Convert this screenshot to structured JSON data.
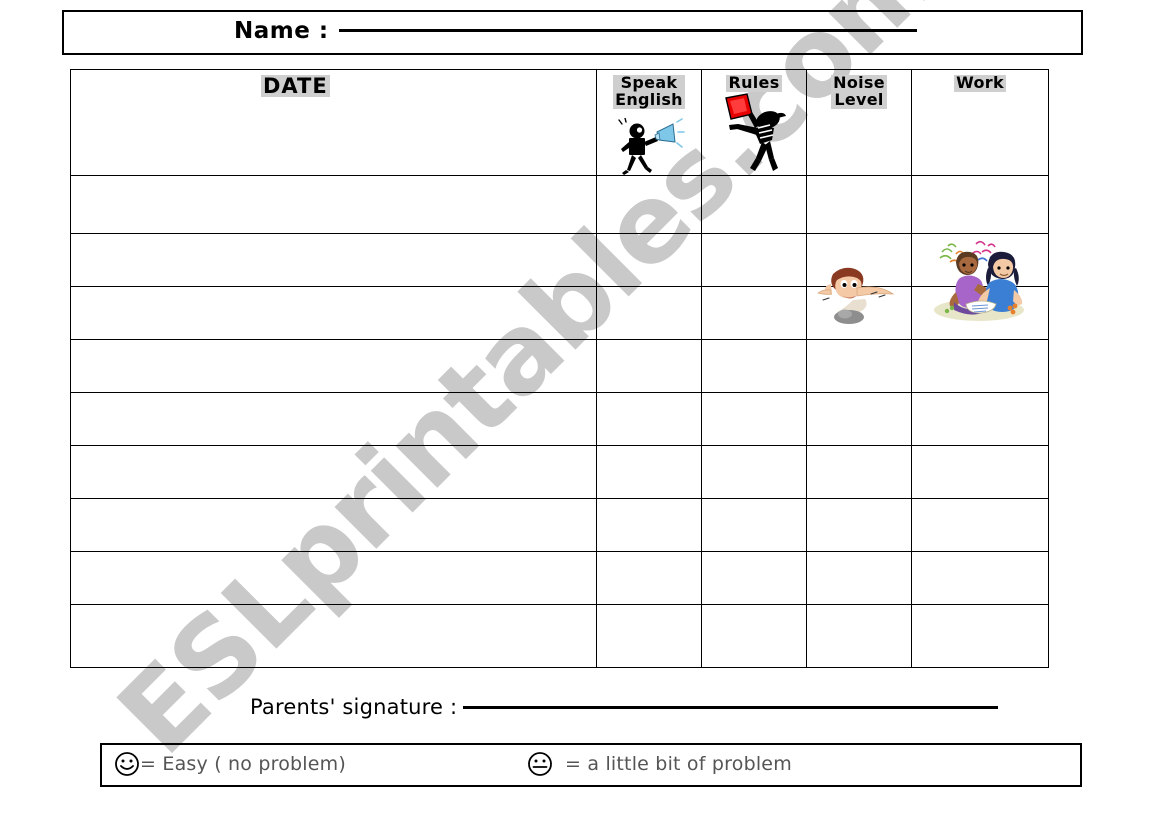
{
  "watermark": {
    "text": "ESLprintables.com"
  },
  "name_bar": {
    "label": "Name :",
    "blank_placeholder": ""
  },
  "table": {
    "headers": [
      {
        "id": "date",
        "label": "DATE",
        "line2": "",
        "icon": ""
      },
      {
        "id": "speak-english",
        "label": "Speak",
        "line2": "English",
        "icon": "megaphone-stick-figure-icon"
      },
      {
        "id": "rules",
        "label": "Rules",
        "line2": "",
        "icon": "referee-red-card-icon"
      },
      {
        "id": "noise-level",
        "label": "Noise",
        "line2": "Level",
        "icon": "boy-covering-ears-icon"
      },
      {
        "id": "work",
        "label": "Work",
        "line2": "",
        "icon": "two-kids-working-icon"
      }
    ],
    "rows": [
      {
        "date": "",
        "speak_english": "",
        "rules": "",
        "noise_level": "",
        "work": ""
      },
      {
        "date": "",
        "speak_english": "",
        "rules": "",
        "noise_level": "",
        "work": ""
      },
      {
        "date": "",
        "speak_english": "",
        "rules": "",
        "noise_level": "",
        "work": ""
      },
      {
        "date": "",
        "speak_english": "",
        "rules": "",
        "noise_level": "",
        "work": ""
      },
      {
        "date": "",
        "speak_english": "",
        "rules": "",
        "noise_level": "",
        "work": ""
      },
      {
        "date": "",
        "speak_english": "",
        "rules": "",
        "noise_level": "",
        "work": ""
      },
      {
        "date": "",
        "speak_english": "",
        "rules": "",
        "noise_level": "",
        "work": ""
      },
      {
        "date": "",
        "speak_english": "",
        "rules": "",
        "noise_level": "",
        "work": ""
      },
      {
        "date": "",
        "speak_english": "",
        "rules": "",
        "noise_level": "",
        "work": ""
      }
    ]
  },
  "signature": {
    "label": "Parents' signature :",
    "blank_placeholder": ""
  },
  "legend": {
    "entries": [
      {
        "id": "easy",
        "face": "smiley-face-icon",
        "text": "= Easy ( no problem)"
      },
      {
        "id": "little-problem",
        "face": "neutral-face-icon",
        "text": "= a little bit of  problem"
      }
    ]
  },
  "colors": {
    "highlight": "#cfcfcf",
    "border": "#000000",
    "watermark": "#c9c9c9",
    "legend_text": "#555555",
    "red_card": "#e60000",
    "megaphone": "#7fc7e8"
  }
}
